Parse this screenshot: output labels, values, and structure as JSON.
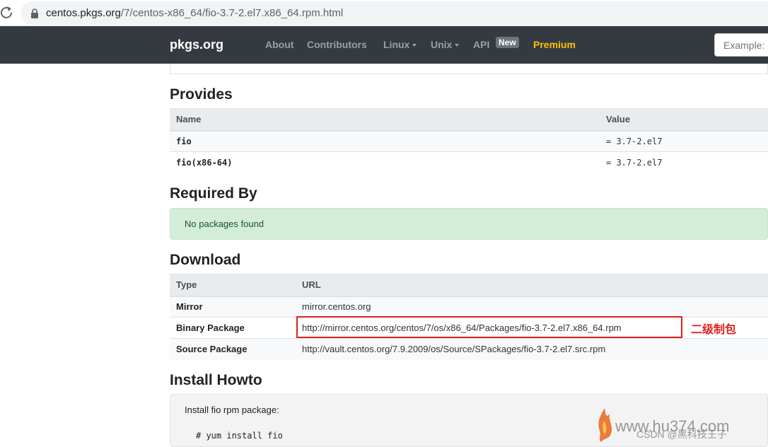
{
  "browser": {
    "url_host": "centos.pkgs.org",
    "url_path": "/7/centos-x86_64/fio-3.7-2.el7.x86_64.rpm.html"
  },
  "nav": {
    "brand": "pkgs.org",
    "links": [
      "About",
      "Contributors",
      "Linux",
      "Unix",
      "API"
    ],
    "api_badge": "New",
    "premium": "Premium",
    "search_placeholder": "Example:"
  },
  "provides": {
    "heading": "Provides",
    "columns": [
      "Name",
      "Value"
    ],
    "rows": [
      {
        "name": "fio",
        "value": "= 3.7-2.el7"
      },
      {
        "name": "fio(x86-64)",
        "value": "= 3.7-2.el7"
      }
    ]
  },
  "required_by": {
    "heading": "Required By",
    "message": "No packages found"
  },
  "download": {
    "heading": "Download",
    "columns": [
      "Type",
      "URL"
    ],
    "rows": [
      {
        "type": "Mirror",
        "url": "mirror.centos.org"
      },
      {
        "type": "Binary Package",
        "url": "http://mirror.centos.org/centos/7/os/x86_64/Packages/fio-3.7-2.el7.x86_64.rpm"
      },
      {
        "type": "Source Package",
        "url": "http://vault.centos.org/7.9.2009/os/Source/SPackages/fio-3.7-2.el7.src.rpm"
      }
    ]
  },
  "annotation": "二级制包",
  "install": {
    "heading": "Install Howto",
    "intro": "Install fio rpm package:",
    "command": "# yum install fio"
  },
  "watermark": {
    "site": "www.hu374.com",
    "credit": "CSDN @黑科技王子"
  },
  "colors": {
    "navbar": "#343a40",
    "premium": "#ffc107",
    "alert_bg": "#d4edda",
    "highlight": "#e02020"
  }
}
